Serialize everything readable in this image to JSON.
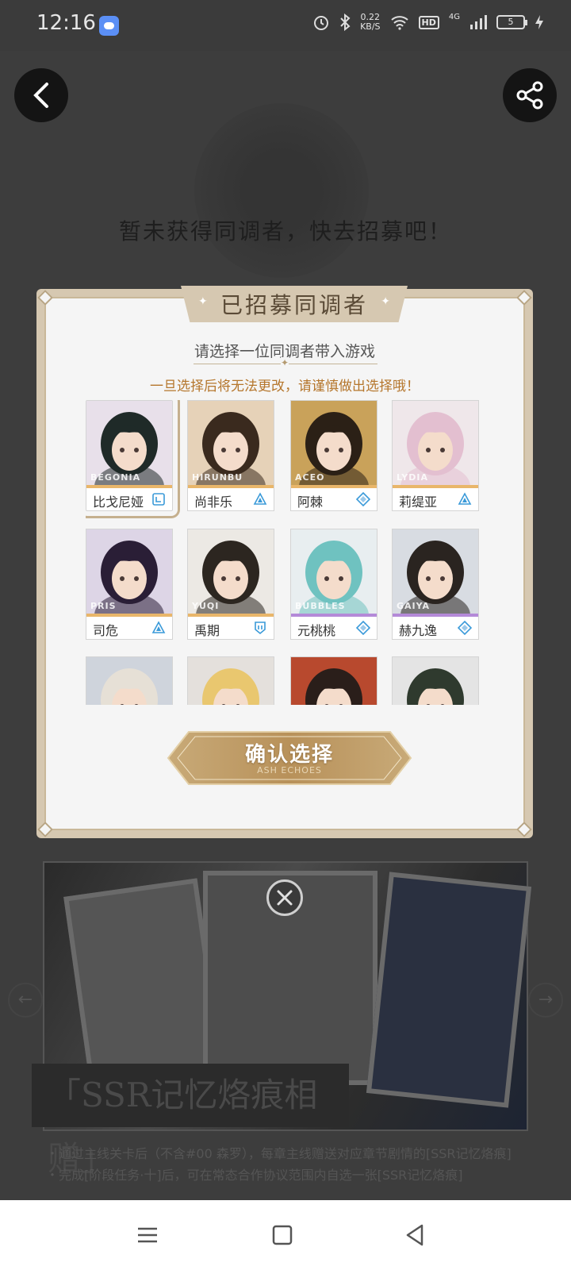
{
  "status_bar": {
    "time": "12:16",
    "net_speed_value": "0.22",
    "net_speed_unit": "KB/S",
    "hd": "HD",
    "signal": "4G",
    "battery": "5"
  },
  "background": {
    "empty_message": "暂未获得同调者，快去招募吧！",
    "banner_title": "「SSR记忆烙痕相赠」",
    "notes": [
      "・通过主线关卡后（不含#00 森罗），每章主线赠送对应章节剧情的[SSR记忆烙痕]",
      "・完成[阶段任务·十]后，可在常态合作协议范围内自选一张[SSR记忆烙痕]"
    ]
  },
  "modal": {
    "title": "已招募同调者",
    "subtitle": "请选择一位同调者带入游戏",
    "warning": "一旦选择后将无法更改，请谨慎做出选择哦！",
    "confirm_label": "确认选择",
    "confirm_sub": "ASH ECHOES"
  },
  "characters": [
    {
      "en": "BEGONIA",
      "cn": "比戈尼娅",
      "selected": true,
      "stripe": "#e9b66a",
      "class_icon": "vanguard-icon",
      "bg": "#e8e0ea",
      "hair": "#1f2a28"
    },
    {
      "en": "HIRUNBU",
      "cn": "尚非乐",
      "selected": false,
      "stripe": "#e9b66a",
      "class_icon": "striker-icon",
      "bg": "#e6d2b8",
      "hair": "#3a2a1e"
    },
    {
      "en": "ACEO",
      "cn": "阿棘",
      "selected": false,
      "stripe": "#e9b66a",
      "class_icon": "support-icon",
      "bg": "#c9a25a",
      "hair": "#2b2016"
    },
    {
      "en": "LYDIA",
      "cn": "莉缇亚",
      "selected": false,
      "stripe": "#e9b66a",
      "class_icon": "striker-icon",
      "bg": "#efe7ea",
      "hair": "#e3bfd0"
    },
    {
      "en": "PRIS",
      "cn": "司危",
      "selected": false,
      "stripe": "#e9b66a",
      "class_icon": "striker-icon",
      "bg": "#ddd5e6",
      "hair": "#2a1e36"
    },
    {
      "en": "YUQI",
      "cn": "禹期",
      "selected": false,
      "stripe": "#e9b66a",
      "class_icon": "guardian-icon",
      "bg": "#ece9e4",
      "hair": "#2c2620"
    },
    {
      "en": "BUBBLES",
      "cn": "元桃桃",
      "selected": false,
      "stripe": "#b48ad8",
      "class_icon": "support-icon",
      "bg": "#e8eef0",
      "hair": "#6fc2c0"
    },
    {
      "en": "GAIYA",
      "cn": "赫九逸",
      "selected": false,
      "stripe": "#b48ad8",
      "class_icon": "support-icon",
      "bg": "#d8dce2",
      "hair": "#2a2420"
    },
    {
      "en": "",
      "cn": "",
      "selected": false,
      "stripe": "#b48ad8",
      "class_icon": "",
      "bg": "#cfd4dc",
      "hair": "#e6e0d6"
    },
    {
      "en": "",
      "cn": "",
      "selected": false,
      "stripe": "#b48ad8",
      "class_icon": "",
      "bg": "#e4e0dc",
      "hair": "#e9c76f"
    },
    {
      "en": "",
      "cn": "",
      "selected": false,
      "stripe": "#b48ad8",
      "class_icon": "",
      "bg": "#b8492e",
      "hair": "#2a1e1a"
    },
    {
      "en": "",
      "cn": "",
      "selected": false,
      "stripe": "#b48ad8",
      "class_icon": "",
      "bg": "#e4e4e4",
      "hair": "#2f3a2e"
    }
  ]
}
